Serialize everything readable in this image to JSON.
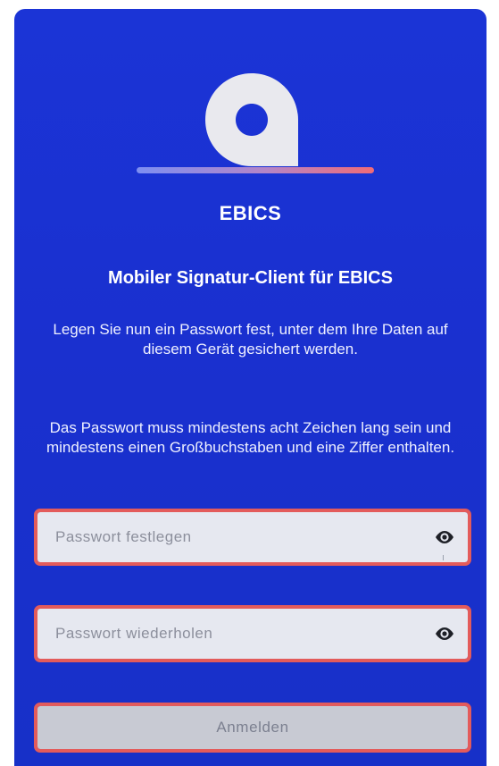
{
  "app": {
    "brand": "EBICS",
    "title": "Mobiler Signatur-Client für EBICS",
    "instruction": "Legen Sie nun ein Passwort fest, unter dem Ihre Daten auf diesem Gerät gesichert werden.",
    "requirements": "Das Passwort muss mindestens acht Zeichen lang sein und mindestens einen Großbuchstaben und eine Ziffer enthalten."
  },
  "form": {
    "password": {
      "placeholder": "Passwort festlegen",
      "value": "",
      "icon": "eye-icon"
    },
    "password_repeat": {
      "placeholder": "Passwort wiederholen",
      "value": "",
      "icon": "eye-icon"
    },
    "submit_label": "Anmelden"
  },
  "colors": {
    "background": "#1b34d6",
    "highlight": "#e35b5b",
    "logo": "#e9e9ee"
  }
}
